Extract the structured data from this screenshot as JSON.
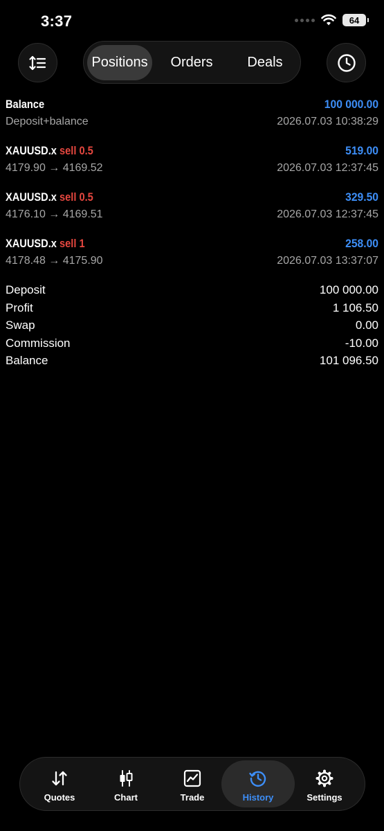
{
  "status": {
    "time": "3:37",
    "battery": "64"
  },
  "toolbar": {
    "tabs": [
      {
        "label": "Positions"
      },
      {
        "label": "Orders"
      },
      {
        "label": "Deals"
      }
    ]
  },
  "items": [
    {
      "symbol": "Balance",
      "side": "",
      "amount": "100 000.00",
      "sub": "Deposit+balance",
      "time": "2026.07.03 10:38:29"
    },
    {
      "symbol": "XAUUSD.x",
      "side": "sell 0.5",
      "amount": "519.00",
      "sub": "4179.90 → 4169.52",
      "time": "2026.07.03 12:37:45"
    },
    {
      "symbol": "XAUUSD.x",
      "side": "sell 0.5",
      "amount": "329.50",
      "sub": "4176.10 → 4169.51",
      "time": "2026.07.03 12:37:45"
    },
    {
      "symbol": "XAUUSD.x",
      "side": "sell 1",
      "amount": "258.00",
      "sub": "4178.48 → 4175.90",
      "time": "2026.07.03 13:37:07"
    }
  ],
  "summary": [
    {
      "label": "Deposit",
      "value": "100 000.00"
    },
    {
      "label": "Profit",
      "value": "1 106.50"
    },
    {
      "label": "Swap",
      "value": "0.00"
    },
    {
      "label": "Commission",
      "value": "-10.00"
    },
    {
      "label": "Balance",
      "value": "101 096.50"
    }
  ],
  "tabbar": {
    "items": [
      {
        "label": "Quotes",
        "icon": "quotes-icon"
      },
      {
        "label": "Chart",
        "icon": "chart-icon"
      },
      {
        "label": "Trade",
        "icon": "trade-icon"
      },
      {
        "label": "History",
        "icon": "history-icon"
      },
      {
        "label": "Settings",
        "icon": "settings-icon"
      }
    ]
  },
  "colors": {
    "accent": "#3d8ef7",
    "sell": "#e5473f",
    "background": "#000000"
  }
}
